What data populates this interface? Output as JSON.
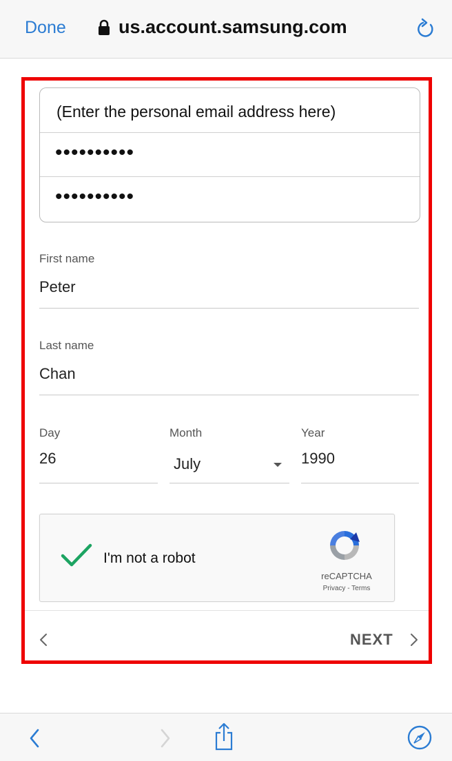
{
  "browser": {
    "done_label": "Done",
    "url": "us.account.samsung.com"
  },
  "form": {
    "email_placeholder": "(Enter the personal email address here)",
    "password": "••••••••••",
    "confirm_password": "••••••••••",
    "first_name_label": "First name",
    "first_name_value": "Peter",
    "last_name_label": "Last name",
    "last_name_value": "Chan",
    "day_label": "Day",
    "day_value": "26",
    "month_label": "Month",
    "month_value": "July",
    "year_label": "Year",
    "year_value": "1990"
  },
  "captcha": {
    "label": "I'm not a robot",
    "brand": "reCAPTCHA",
    "links": "Privacy - Terms",
    "checked": true
  },
  "navigation": {
    "next_label": "NEXT"
  },
  "colors": {
    "accent": "#2b7cd3",
    "highlight_frame": "#ee0000",
    "check": "#1da462"
  }
}
